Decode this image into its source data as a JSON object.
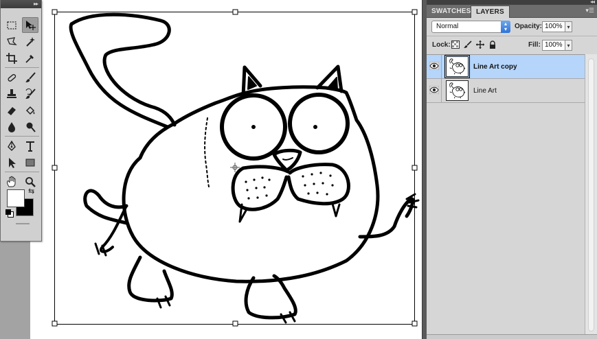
{
  "tools": {
    "items": [
      {
        "name": "marquee-tool-icon"
      },
      {
        "name": "move-tool-icon"
      },
      {
        "name": "lasso-tool-icon"
      },
      {
        "name": "magic-wand-tool-icon"
      },
      {
        "name": "crop-tool-icon"
      },
      {
        "name": "eyedropper-tool-icon"
      },
      {
        "name": "healing-brush-tool-icon"
      },
      {
        "name": "brush-tool-icon"
      },
      {
        "name": "clone-stamp-tool-icon"
      },
      {
        "name": "history-brush-tool-icon"
      },
      {
        "name": "eraser-tool-icon"
      },
      {
        "name": "paint-bucket-tool-icon"
      },
      {
        "name": "blur-tool-icon"
      },
      {
        "name": "dodge-tool-icon"
      },
      {
        "name": "pen-tool-icon"
      },
      {
        "name": "type-tool-icon"
      },
      {
        "name": "path-selection-tool-icon"
      },
      {
        "name": "rectangle-tool-icon"
      },
      {
        "name": "hand-tool-icon"
      },
      {
        "name": "zoom-tool-icon"
      }
    ],
    "foreground_color": "#ffffff",
    "background_color": "#000000"
  },
  "panel": {
    "tabs": [
      {
        "label": "SWATCHES",
        "active": false
      },
      {
        "label": "LAYERS",
        "active": true
      }
    ],
    "blend_mode": "Normal",
    "opacity_label": "Opacity:",
    "opacity_value": "100%",
    "lock_label": "Lock:",
    "fill_label": "Fill:",
    "fill_value": "100%"
  },
  "layers": [
    {
      "name": "Line Art copy",
      "selected": true,
      "visible": true
    },
    {
      "name": "Line Art",
      "selected": false,
      "visible": true
    }
  ],
  "colors": {
    "selection_highlight": "#b5d5fb",
    "accent_blue": "#2d72d9"
  }
}
